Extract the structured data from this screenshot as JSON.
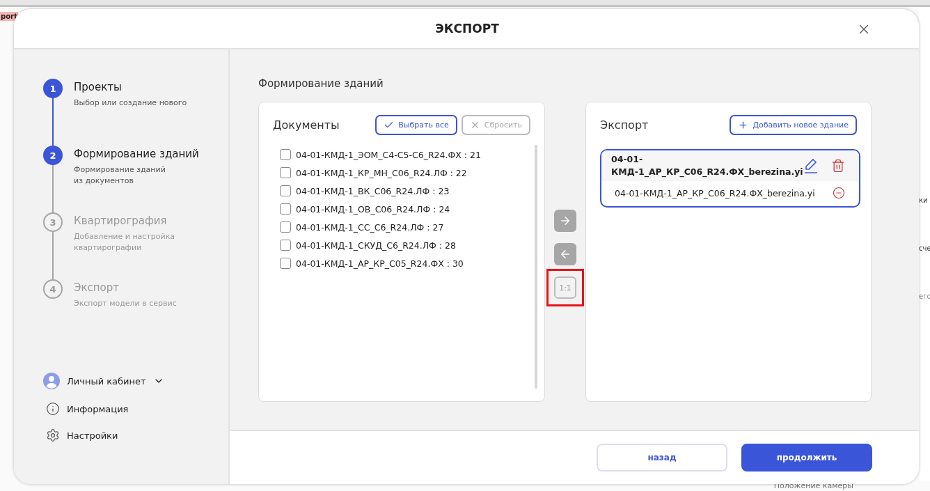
{
  "window": {
    "title": "ЭКСПОРТ"
  },
  "background": {
    "tab_label": "port",
    "fragments": [
      "ки",
      "сче",
      "его"
    ],
    "footer_text": "Положение камеры"
  },
  "steps": [
    {
      "number": "1",
      "title": "Проекты",
      "subtitle": "Выбор или создание нового",
      "active": true
    },
    {
      "number": "2",
      "title": "Формирование зданий",
      "subtitle": "Формирование зданий\nиз документов",
      "active": true
    },
    {
      "number": "3",
      "title": "Квартирография",
      "subtitle": "Добавление и настройка\nквартирографии",
      "active": false
    },
    {
      "number": "4",
      "title": "Экспорт",
      "subtitle": "Экспорт модели в сервис",
      "active": false
    }
  ],
  "sidebar_links": [
    {
      "kind": "account",
      "label": "Личный кабинет"
    },
    {
      "kind": "info",
      "label": "Информация"
    },
    {
      "kind": "settings",
      "label": "Настройки"
    }
  ],
  "section_title": "Формирование зданий",
  "documents": {
    "title": "Документы",
    "select_all": {
      "label": "Выбрать все",
      "disabled": false
    },
    "reset": {
      "label": "Сбросить",
      "disabled": true
    },
    "items": [
      {
        "label": "04-01-КМД-1_ЭОМ_С4-С5-С6_R24.ФХ : 21",
        "checked": false
      },
      {
        "label": "04-01-КМД-1_КР_МН_С06_R24.ЛФ : 22",
        "checked": false
      },
      {
        "label": "04-01-КМД-1_ВК_С06_R24.ЛФ : 23",
        "checked": false
      },
      {
        "label": "04-01-КМД-1_ОВ_С06_R24.ЛФ : 24",
        "checked": false
      },
      {
        "label": "04-01-КМД-1_СС_С6_R24.ЛФ : 27",
        "checked": false
      },
      {
        "label": "04-01-КМД-1_СКУД_С6_R24.ЛФ : 28",
        "checked": false
      },
      {
        "label": "04-01-КМД-1_АР_КР_С05_R24.ФХ : 30",
        "checked": false
      }
    ]
  },
  "transfer_buttons": [
    {
      "kind": "right",
      "disabled": false,
      "highlighted": false
    },
    {
      "kind": "left",
      "disabled": false,
      "highlighted": false
    },
    {
      "kind": "ratio",
      "label": "1:1",
      "disabled": true,
      "highlighted": true
    }
  ],
  "export": {
    "title": "Экспорт",
    "add_button": "Добавить новое здание",
    "buildings": [
      {
        "name": "04-01-\nКМД-1_АР_КР_С06_R24.ФХ_berezina.yi",
        "selected": true,
        "files": [
          "04-01-КМД-1_АР_КР_С06_R24.ФХ_berezina.yi"
        ]
      }
    ]
  },
  "footer": {
    "back": "назад",
    "next": "продолжить"
  }
}
